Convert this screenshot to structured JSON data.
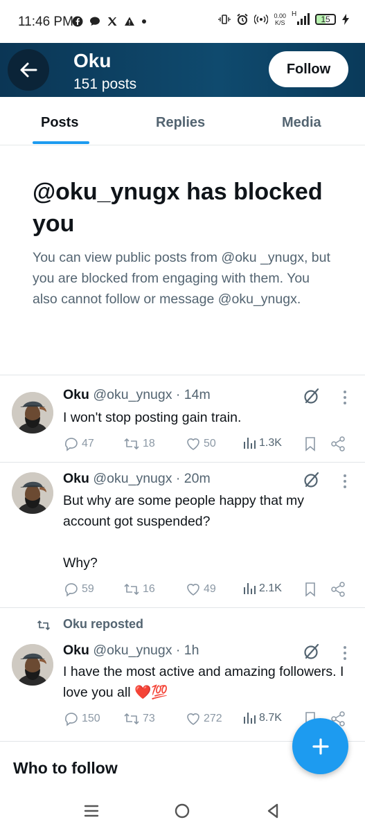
{
  "status_bar": {
    "time": "11:46 PM",
    "speed_value": "0.00",
    "speed_unit": "K/S",
    "signal_label": "H",
    "battery": "15"
  },
  "header": {
    "name": "Oku",
    "posts_count": "151 posts",
    "follow_label": "Follow"
  },
  "tabs": [
    {
      "label": "Posts",
      "active": true
    },
    {
      "label": "Replies",
      "active": false
    },
    {
      "label": "Media",
      "active": false
    }
  ],
  "blocked": {
    "title": "@oku_ynugx has blocked you",
    "description": "You can view public posts from @oku _ynugx, but you are blocked from engaging with them. You also cannot follow or message @oku_ynugx."
  },
  "posts": [
    {
      "name": "Oku",
      "handle_time": "@oku_ynugx · 14m",
      "text": "I won't stop posting gain train.",
      "replies": "47",
      "reposts": "18",
      "likes": "50",
      "views": "1.3K"
    },
    {
      "name": "Oku",
      "handle_time": "@oku_ynugx · 20m",
      "text": "But why are some people happy that my account got suspended?\n\nWhy?",
      "replies": "59",
      "reposts": "16",
      "likes": "49",
      "views": "2.1K"
    },
    {
      "repost_label": "Oku reposted",
      "name": "Oku",
      "handle_time": "@oku_ynugx · 1h",
      "text": "I have the most active and amazing followers. I love you all ❤️💯",
      "replies": "150",
      "reposts": "73",
      "likes": "272",
      "views": "8.7K"
    }
  ],
  "who_to_follow": "Who to follow",
  "colors": {
    "accent": "#1d9bf0",
    "header_bg": "#0f4a6e",
    "muted_text": "#536471"
  }
}
